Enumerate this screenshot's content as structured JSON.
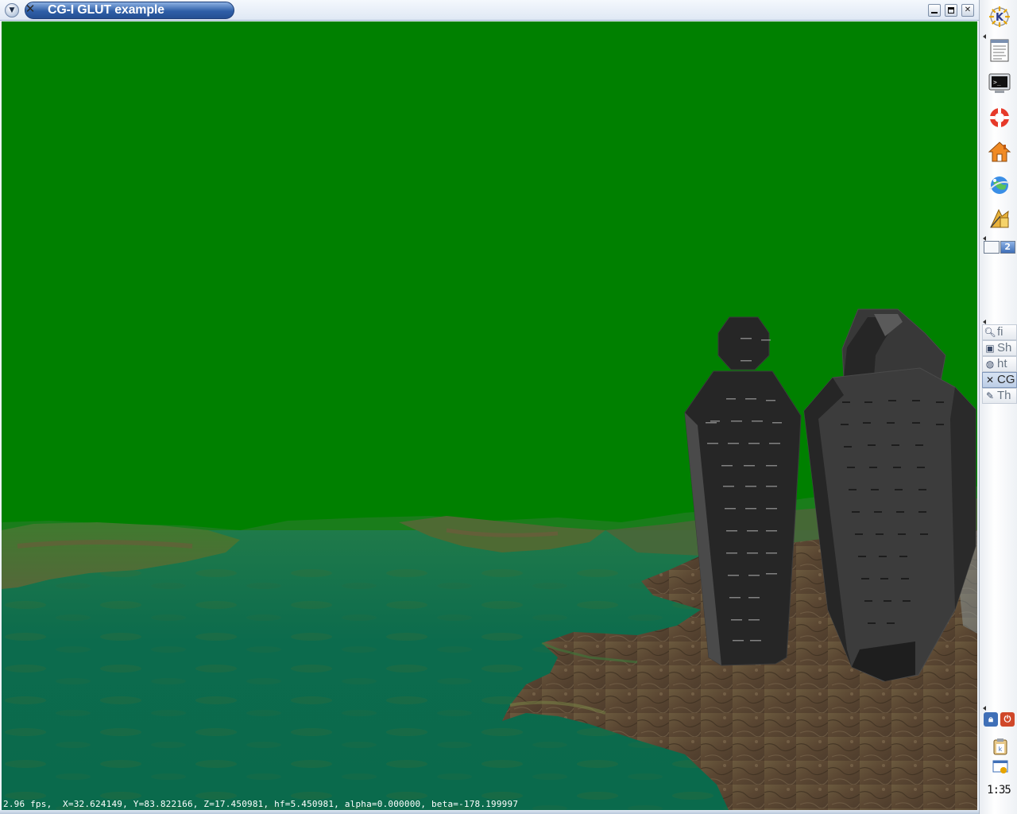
{
  "window": {
    "title": "CG-I GLUT example",
    "menu_icon": "chevron-down-icon",
    "app_icon": "x-icon",
    "buttons": {
      "minimize": "minimize-icon",
      "maximize": "maximize-icon",
      "close": "close-icon"
    }
  },
  "scene": {
    "sky_color": "#008000",
    "water_color": "#0a6a4c",
    "terrain_color": "#5c4a36",
    "statue_color": "#262626",
    "hud_text": "2.96 fps,  X=32.624149, Y=83.822166, Z=17.450981, hf=5.450981, alpha=0.000000, beta=-178.199997"
  },
  "panel": {
    "launchers": [
      {
        "name": "kmenu-icon"
      },
      {
        "name": "text-editor-icon"
      },
      {
        "name": "terminal-icon"
      },
      {
        "name": "help-lifebuoy-icon"
      },
      {
        "name": "home-folder-icon"
      },
      {
        "name": "web-browser-icon"
      },
      {
        "name": "control-center-icon"
      }
    ],
    "pager": {
      "desktops": [
        "",
        "2"
      ],
      "active": 1
    },
    "tasks": [
      {
        "icon": "search-icon",
        "label": "fi",
        "active": false
      },
      {
        "icon": "monitor-icon",
        "label": "Sh",
        "active": false
      },
      {
        "icon": "globe-icon",
        "label": "ht",
        "active": false
      },
      {
        "icon": "x-icon",
        "label": "CG",
        "active": true
      },
      {
        "icon": "gimp-icon",
        "label": "Th",
        "active": false
      }
    ],
    "tray": {
      "lock": "lock-icon",
      "logout": "power-icon",
      "klipper": "clipboard-icon",
      "kmix": "update-icon"
    },
    "clock": "1:35",
    "accent": "#3f6fb7"
  }
}
